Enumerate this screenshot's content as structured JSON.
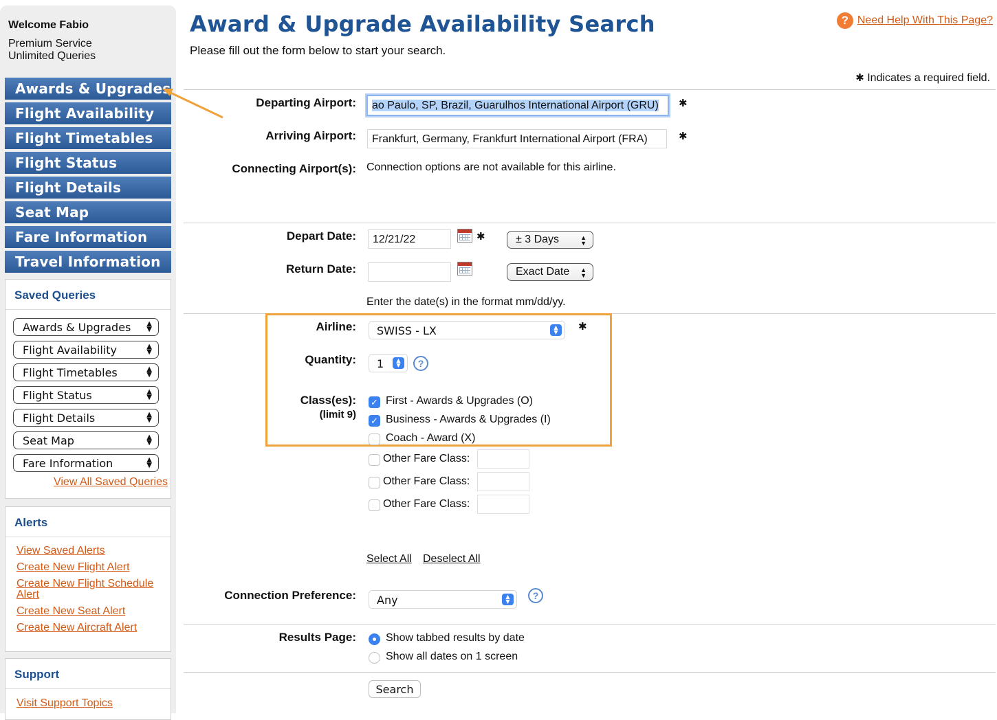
{
  "sidebar": {
    "welcome": "Welcome Fabio",
    "service": "Premium Service",
    "queries": "Unlimited Queries",
    "nav": [
      "Awards & Upgrades",
      "Flight Availability",
      "Flight Timetables",
      "Flight Status",
      "Flight Details",
      "Seat Map",
      "Fare Information",
      "Travel Information"
    ],
    "saved_title": "Saved Queries",
    "saved_selects": [
      "Awards & Upgrades",
      "Flight Availability",
      "Flight Timetables",
      "Flight Status",
      "Flight Details",
      "Seat Map",
      "Fare Information"
    ],
    "view_all": "View All Saved Queries",
    "alerts_title": "Alerts",
    "alert_links": [
      "View Saved Alerts",
      "Create New Flight Alert",
      "Create New Flight Schedule Alert",
      "Create New Seat Alert",
      "Create New Aircraft Alert"
    ],
    "support_title": "Support",
    "support_link": "Visit Support Topics"
  },
  "header": {
    "title": "Award & Upgrade Availability Search",
    "subtitle": "Please fill out the form below to start your search.",
    "help": "Need Help With This Page?",
    "req_star": "✱",
    "req_note": "Indicates a required field."
  },
  "form": {
    "departing_label": "Departing Airport:",
    "departing_value": "ao Paulo, SP, Brazil, Guarulhos International Airport (GRU)",
    "arriving_label": "Arriving Airport:",
    "arriving_value": "Frankfurt, Germany, Frankfurt International Airport (FRA)",
    "connecting_label": "Connecting Airport(s):",
    "connecting_note": "Connection options are not available for this airline.",
    "depart_label": "Depart Date:",
    "depart_value": "12/21/22",
    "depart_range": "± 3 Days",
    "return_label": "Return Date:",
    "return_value": "",
    "return_range": "Exact Date",
    "date_hint": "Enter the date(s) in the format mm/dd/yy.",
    "airline_label": "Airline:",
    "airline_value": "SWISS - LX",
    "quantity_label": "Quantity:",
    "quantity_value": "1",
    "classes_label": "Class(es):",
    "classes_limit": "(limit 9)",
    "classes": [
      {
        "label": "First - Awards & Upgrades (O)",
        "checked": true
      },
      {
        "label": "Business - Awards & Upgrades (I)",
        "checked": true
      },
      {
        "label": "Coach - Award (X)",
        "checked": false
      }
    ],
    "other_fare": [
      "Other Fare Class:",
      "Other Fare Class:",
      "Other Fare Class:"
    ],
    "select_all": "Select All",
    "deselect_all": "Deselect All",
    "connection_label": "Connection Preference:",
    "connection_value": "Any",
    "results_label": "Results Page:",
    "results_options": [
      {
        "label": "Show tabbed results by date",
        "selected": true
      },
      {
        "label": "Show all dates on 1 screen",
        "selected": false
      }
    ],
    "search": "Search"
  },
  "icons": {
    "help": "question-circle-icon",
    "calendar": "calendar-icon",
    "info": "info-question-icon",
    "annotation": "orange-arrow-annotation"
  },
  "colors": {
    "nav_blue": "#2c5a97",
    "title_blue": "#1f5495",
    "link_orange": "#d25a16",
    "highlight_orange": "#f0a23a",
    "control_blue": "#3b82f0"
  }
}
